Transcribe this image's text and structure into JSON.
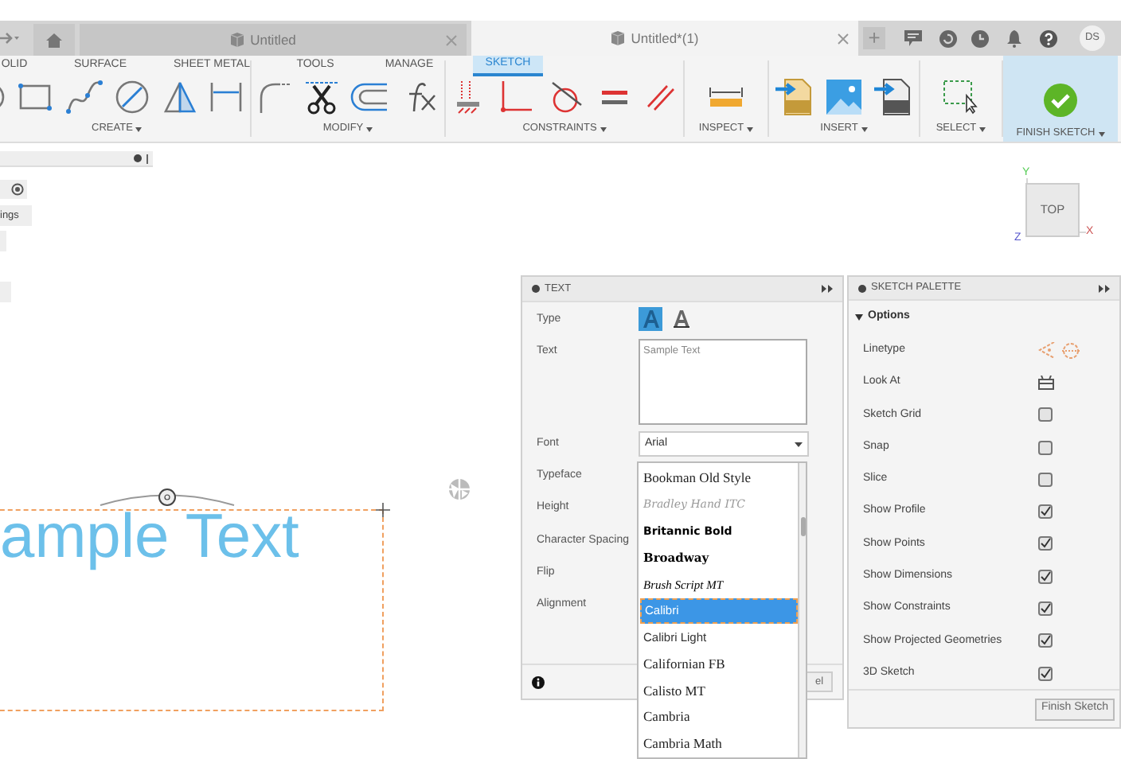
{
  "tab_bar": {
    "tabs": [
      {
        "label": "Untitled",
        "selected": false
      },
      {
        "label": "Untitled*(1)",
        "selected": true
      }
    ],
    "new_tab": "+",
    "user_initials": "DS"
  },
  "toolbar": {
    "workspace_tabs": [
      {
        "label": "OLID",
        "selected": false
      },
      {
        "label": "SURFACE",
        "selected": false
      },
      {
        "label": "SHEET METAL",
        "selected": false
      },
      {
        "label": "TOOLS",
        "selected": false
      },
      {
        "label": "MANAGE",
        "selected": false
      },
      {
        "label": "SKETCH",
        "selected": true
      }
    ],
    "groups": [
      {
        "kind": "create",
        "label": "CREATE"
      },
      {
        "kind": "modify",
        "label": "MODIFY"
      },
      {
        "kind": "constraints",
        "label": "CONSTRAINTS"
      },
      {
        "kind": "inspect",
        "label": "INSPECT"
      },
      {
        "kind": "insert",
        "label": "INSERT"
      },
      {
        "kind": "select",
        "label": "SELECT"
      },
      {
        "kind": "finish",
        "label": "FINISH SKETCH"
      }
    ]
  },
  "browser": {
    "item_label": "ings"
  },
  "canvas": {
    "sketch_text": "ample Text",
    "view_cube": {
      "face": "TOP",
      "axes": [
        "Y",
        "Z",
        "X"
      ]
    }
  },
  "text_panel": {
    "title": "TEXT",
    "fields": [
      {
        "kind": "type",
        "label": "Type"
      },
      {
        "kind": "textarea",
        "label": "Text",
        "value": "Sample Text"
      },
      {
        "kind": "select",
        "label": "Font",
        "value": "Arial"
      },
      {
        "kind": "plain",
        "label": "Typeface"
      },
      {
        "kind": "plain",
        "label": "Height"
      },
      {
        "kind": "plain",
        "label": "Character Spacing"
      },
      {
        "kind": "plain",
        "label": "Flip"
      },
      {
        "kind": "plain",
        "label": "Alignment"
      }
    ],
    "footer_button": "el",
    "font_list": [
      {
        "label": "Bookman Old Style",
        "kind": "serif",
        "selected": false
      },
      {
        "label": "Bradley Hand ITC",
        "kind": "light",
        "selected": false
      },
      {
        "label": "Britannic Bold",
        "kind": "bold",
        "selected": false
      },
      {
        "label": "Broadway",
        "kind": "heavy",
        "selected": false
      },
      {
        "label": "Brush Script MT",
        "kind": "script",
        "selected": false
      },
      {
        "label": "Calibri",
        "kind": "sans",
        "selected": true
      },
      {
        "label": "Calibri Light",
        "kind": "sans",
        "selected": false
      },
      {
        "label": "Californian FB",
        "kind": "serif",
        "selected": false
      },
      {
        "label": "Calisto MT",
        "kind": "serif",
        "selected": false
      },
      {
        "label": "Cambria",
        "kind": "serif",
        "selected": false
      },
      {
        "label": "Cambria Math",
        "kind": "serif",
        "selected": false
      }
    ]
  },
  "sketch_palette": {
    "title": "SKETCH PALETTE",
    "section": "Options",
    "expanded": true,
    "rows": [
      {
        "kind": "linetype",
        "label": "Linetype"
      },
      {
        "kind": "look_at",
        "label": "Look At"
      },
      {
        "kind": "checkbox",
        "label": "Sketch Grid",
        "checked": false
      },
      {
        "kind": "checkbox",
        "label": "Snap",
        "checked": false
      },
      {
        "kind": "checkbox",
        "label": "Slice",
        "checked": false
      },
      {
        "kind": "checkbox",
        "label": "Show Profile",
        "checked": true
      },
      {
        "kind": "checkbox",
        "label": "Show Points",
        "checked": true
      },
      {
        "kind": "checkbox",
        "label": "Show Dimensions",
        "checked": true
      },
      {
        "kind": "checkbox",
        "label": "Show Constraints",
        "checked": true
      },
      {
        "kind": "checkbox",
        "label": "Show Projected Geometries",
        "checked": true
      },
      {
        "kind": "checkbox",
        "label": "3D Sketch",
        "checked": true
      }
    ],
    "finish_button": "Finish Sketch"
  }
}
